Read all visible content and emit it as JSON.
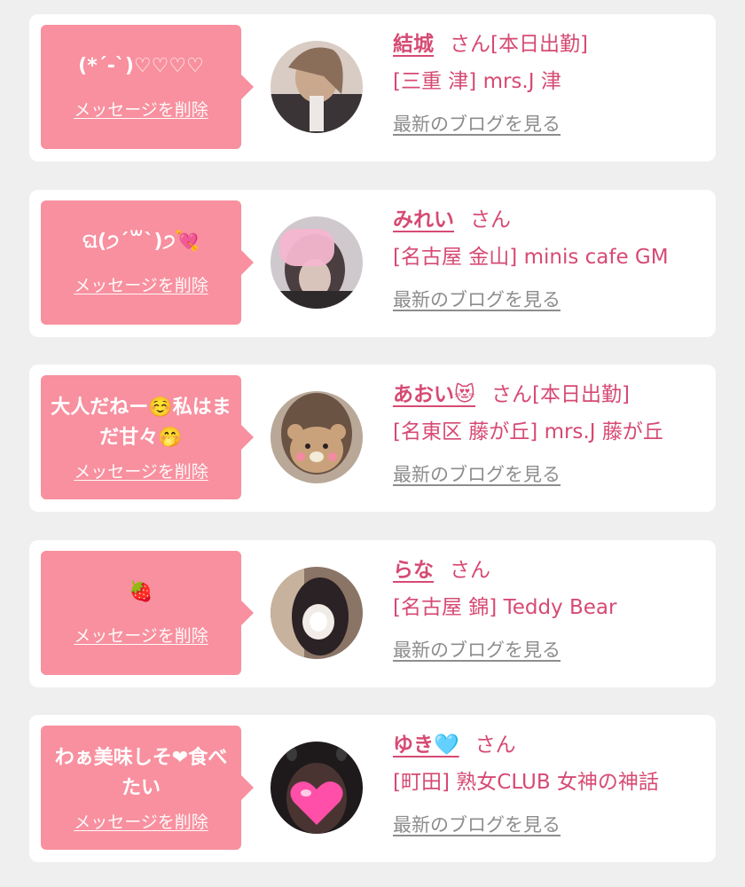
{
  "delete_label": "メッセージを削除",
  "blog_label": "最新のブログを見る",
  "messages": [
    {
      "message": "(*´-`)♡♡♡♡",
      "name": "結城",
      "san": "さん[本日出勤]",
      "shop": "[三重 津] mrs.J 津",
      "avatar": "avatar-photo-1"
    },
    {
      "message": "ଘ(੭ˊ꒳ˋ)੭💘",
      "name": "みれい",
      "san": "さん",
      "shop": "[名古屋 金山] minis cafe GM",
      "avatar": "avatar-photo-2"
    },
    {
      "message": "大人だねー☺️私はまだ甘々🤭",
      "name": "あおい😻",
      "san": "さん[本日出勤]",
      "shop": "[名東区 藤が丘] mrs.J 藤が丘",
      "avatar": "avatar-photo-3"
    },
    {
      "message": "🍓",
      "name": "らな",
      "san": "さん",
      "shop": "[名古屋 錦] Teddy Bear",
      "avatar": "avatar-photo-4"
    },
    {
      "message": "わぁ美味しそ❤食べたい",
      "name": "ゆき🩵",
      "san": "さん",
      "shop": "[町田] 熟女CLUB 女神の神話",
      "avatar": "avatar-photo-5"
    }
  ],
  "colors": {
    "bubble": "#f8909f",
    "accent": "#d64a73",
    "link_gray": "#8d8d8d",
    "background": "#efefef"
  }
}
